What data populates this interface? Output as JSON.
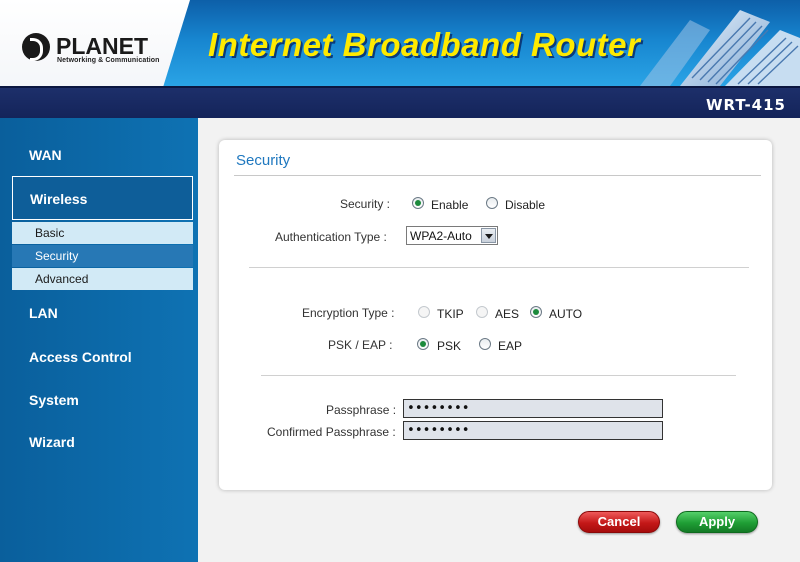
{
  "header": {
    "logo_text": "PLANET",
    "logo_tagline": "Networking & Communication",
    "title": "Internet Broadband Router",
    "model": "WRT-415"
  },
  "sidebar": {
    "items": [
      {
        "label": "WAN"
      },
      {
        "label": "Wireless",
        "expanded": true
      },
      {
        "label": "LAN"
      },
      {
        "label": "Access Control"
      },
      {
        "label": "System"
      },
      {
        "label": "Wizard"
      }
    ],
    "wireless_sub": [
      {
        "label": "Basic"
      },
      {
        "label": "Security",
        "active": true
      },
      {
        "label": "Advanced"
      }
    ]
  },
  "panel": {
    "title": "Security",
    "security": {
      "label": "Security :",
      "options": [
        "Enable",
        "Disable"
      ],
      "selected": "Enable"
    },
    "auth_type": {
      "label": "Authentication Type :",
      "value": "WPA2-Auto"
    },
    "encryption": {
      "label": "Encryption Type :",
      "options": [
        "TKIP",
        "AES",
        "AUTO"
      ],
      "selected": "AUTO"
    },
    "psk_eap": {
      "label": "PSK / EAP :",
      "options": [
        "PSK",
        "EAP"
      ],
      "selected": "PSK"
    },
    "passphrase": {
      "label": "Passphrase :",
      "value": "••••••••"
    },
    "confirmed_passphrase": {
      "label": "Confirmed Passphrase :",
      "value": "••••••••"
    }
  },
  "buttons": {
    "cancel": "Cancel",
    "apply": "Apply"
  },
  "colors": {
    "banner_blue": "#1785cf",
    "model_bar": "#1d2f6a",
    "sidebar": "#0e72b3",
    "title_yellow": "#ffea00",
    "panel_title": "#1f78bf",
    "cancel_red": "#c41818",
    "apply_green": "#1f9e35"
  }
}
